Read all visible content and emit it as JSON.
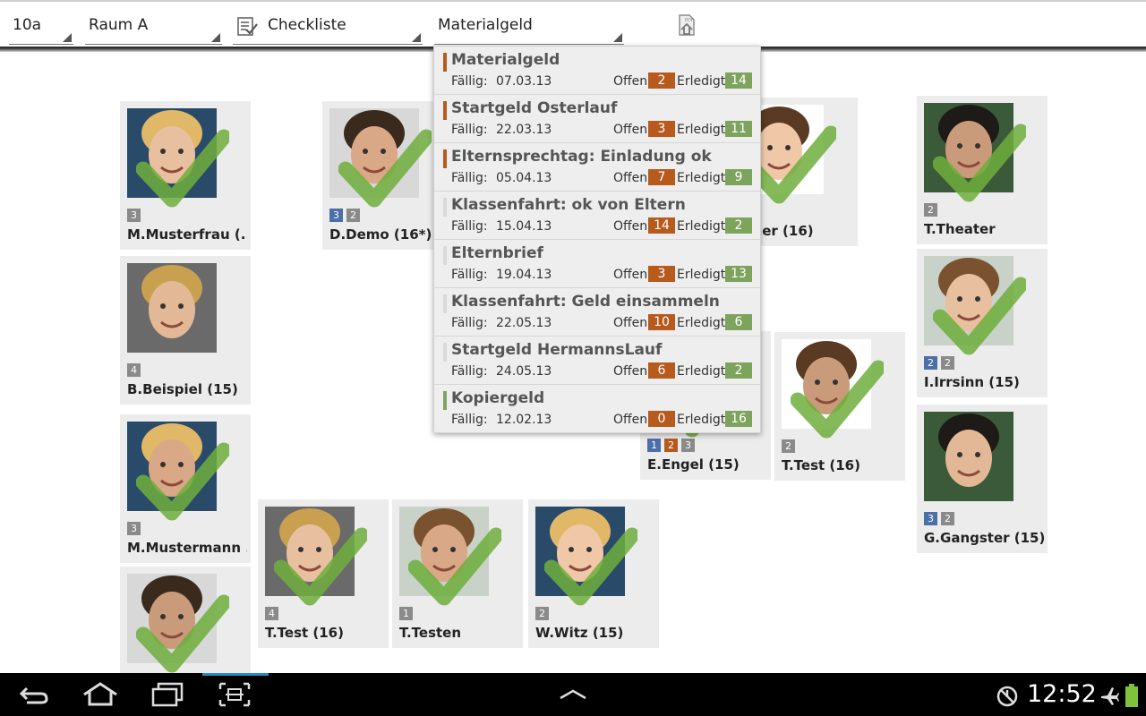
{
  "toolbar": {
    "class_value": "10a",
    "room_value": "Raum A",
    "mode_value": "Checkliste",
    "item_value": "Materialgeld"
  },
  "students": [
    {
      "id": "s1",
      "name": "M.Musterfrau  (...",
      "badges": [
        {
          "n": "3",
          "c": "gray"
        }
      ],
      "checked": true
    },
    {
      "id": "s2",
      "name": "D.Demo  (16*)",
      "badges": [
        {
          "n": "3",
          "c": "blue"
        },
        {
          "n": "2",
          "c": "gray"
        }
      ],
      "checked": true
    },
    {
      "id": "s3",
      "name": "mmer  (16)",
      "badges": [],
      "checked": true
    },
    {
      "id": "s4",
      "name": "T.Theater",
      "badges": [
        {
          "n": "2",
          "c": "gray"
        }
      ],
      "checked": true
    },
    {
      "id": "s5",
      "name": "B.Beispiel  (15)",
      "badges": [
        {
          "n": "4",
          "c": "gray"
        }
      ],
      "checked": false
    },
    {
      "id": "s6",
      "name": "I.Irrsinn  (15)",
      "badges": [
        {
          "n": "2",
          "c": "blue"
        },
        {
          "n": "2",
          "c": "gray"
        }
      ],
      "checked": true
    },
    {
      "id": "s7",
      "name": "M.Mustermann ...",
      "badges": [
        {
          "n": "3",
          "c": "gray"
        }
      ],
      "checked": true
    },
    {
      "id": "s8",
      "name": "E.Engel  (15)",
      "badges": [
        {
          "n": "1",
          "c": "blue"
        },
        {
          "n": "2",
          "c": "orange"
        },
        {
          "n": "3",
          "c": "gray"
        }
      ],
      "checked": true
    },
    {
      "id": "s9",
      "name": "T.Test  (16)",
      "badges": [
        {
          "n": "2",
          "c": "gray"
        }
      ],
      "checked": true
    },
    {
      "id": "s10",
      "name": "G.Gangster  (15)",
      "badges": [
        {
          "n": "3",
          "c": "blue"
        },
        {
          "n": "2",
          "c": "gray"
        }
      ],
      "checked": false
    },
    {
      "id": "s11",
      "name": "T.Test  (16)",
      "badges": [
        {
          "n": "4",
          "c": "gray"
        }
      ],
      "checked": true
    },
    {
      "id": "s12",
      "name": "T.Testen",
      "badges": [
        {
          "n": "1",
          "c": "gray"
        }
      ],
      "checked": true
    },
    {
      "id": "s13",
      "name": "W.Witz  (15)",
      "badges": [
        {
          "n": "2",
          "c": "gray"
        }
      ],
      "checked": true
    },
    {
      "id": "s14",
      "name": "",
      "badges": [],
      "checked": true
    }
  ],
  "dropdown": {
    "due_label": "Fällig:",
    "open_label": "Offen:",
    "done_label": "Erledigt:",
    "items": [
      {
        "title": "Materialgeld",
        "due": "07.03.13",
        "open": "2",
        "done": "14",
        "marker": "#b65a1d"
      },
      {
        "title": "Startgeld Osterlauf",
        "due": "22.03.13",
        "open": "3",
        "done": "11",
        "marker": "#b65a1d"
      },
      {
        "title": "Elternsprechtag: Einladung ok",
        "due": "05.04.13",
        "open": "7",
        "done": "9",
        "marker": "#b65a1d"
      },
      {
        "title": "Klassenfahrt: ok von Eltern",
        "due": "15.04.13",
        "open": "14",
        "done": "2",
        "marker": "#d9d9d9"
      },
      {
        "title": "Elternbrief",
        "due": "19.04.13",
        "open": "3",
        "done": "13",
        "marker": "#d9d9d9"
      },
      {
        "title": "Klassenfahrt: Geld einsammeln",
        "due": "22.05.13",
        "open": "10",
        "done": "6",
        "marker": "#d9d9d9"
      },
      {
        "title": "Startgeld HermannsLauf",
        "due": "24.05.13",
        "open": "6",
        "done": "2",
        "marker": "#d9d9d9"
      },
      {
        "title": "Kopiergeld",
        "due": "12.02.13",
        "open": "0",
        "done": "16",
        "marker": "#7da35d"
      }
    ]
  },
  "system": {
    "clock": "12:52",
    "icons": [
      "back-icon",
      "home-icon",
      "recent-apps-icon",
      "screenshot-icon",
      "up-chevron-icon",
      "usb-debug-icon",
      "airplane-mode-icon",
      "battery-icon"
    ]
  },
  "colors": {
    "check": "#6fae3c",
    "open": "#b65a1d",
    "done": "#7da35d",
    "blue_badge": "#4c6fa8",
    "card_bg": "#ececec"
  }
}
